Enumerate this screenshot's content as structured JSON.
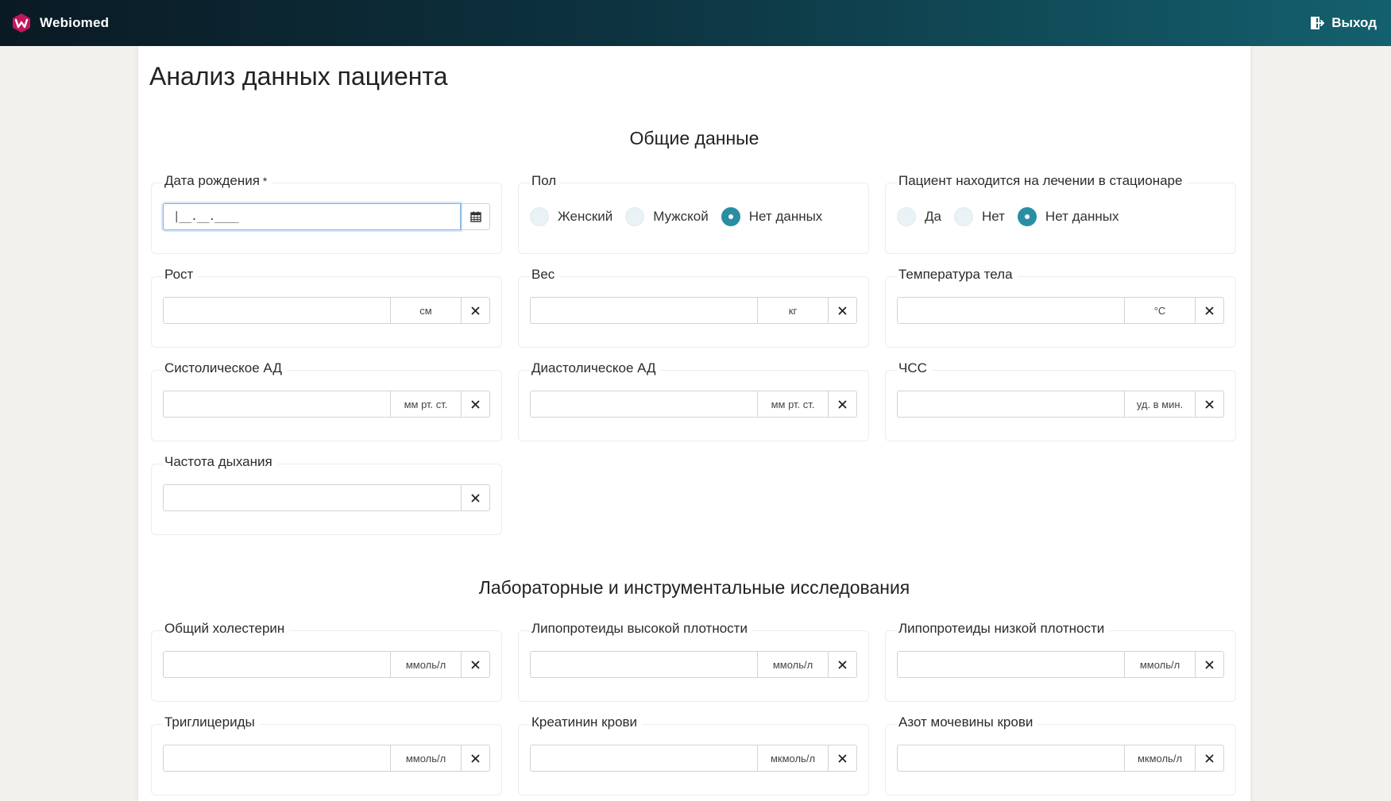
{
  "header": {
    "brand": "Webiomed",
    "logout_label": "Выход"
  },
  "page": {
    "title": "Анализ данных пациента"
  },
  "sections": {
    "general": "Общие данные",
    "lab": "Лабораторные и инструментальные исследования"
  },
  "fields": {
    "birth_date": {
      "label": "Дата рождения",
      "required_mark": "*",
      "mask": "|__.__.____"
    },
    "sex": {
      "label": "Пол",
      "options": [
        "Женский",
        "Мужской",
        "Нет данных"
      ],
      "selected": "Нет данных"
    },
    "inpatient": {
      "label": "Пациент находится на лечении в стационаре",
      "options": [
        "Да",
        "Нет",
        "Нет данных"
      ],
      "selected": "Нет данных"
    },
    "height": {
      "label": "Рост",
      "unit": "см",
      "value": ""
    },
    "weight": {
      "label": "Вес",
      "unit": "кг",
      "value": ""
    },
    "temperature": {
      "label": "Температура тела",
      "unit": "°C",
      "value": ""
    },
    "systolic": {
      "label": "Систолическое АД",
      "unit": "мм рт. ст.",
      "value": ""
    },
    "diastolic": {
      "label": "Диастолическое АД",
      "unit": "мм рт. ст.",
      "value": ""
    },
    "heart_rate": {
      "label": "ЧСС",
      "unit": "уд. в мин.",
      "value": ""
    },
    "resp_rate": {
      "label": "Частота дыхания",
      "value": ""
    },
    "cholesterol": {
      "label": "Общий холестерин",
      "unit": "ммоль/л",
      "value": ""
    },
    "hdl": {
      "label": "Липопротеиды высокой плотности",
      "unit": "ммоль/л",
      "value": ""
    },
    "ldl": {
      "label": "Липопротеиды низкой плотности",
      "unit": "ммоль/л",
      "value": ""
    },
    "triglycerides": {
      "label": "Триглицериды",
      "unit": "ммоль/л",
      "value": ""
    },
    "creatinine": {
      "label": "Креатинин крови",
      "unit": "мкмоль/л",
      "value": ""
    },
    "urea": {
      "label": "Азот мочевины крови",
      "unit": "мкмоль/л",
      "value": ""
    }
  },
  "colors": {
    "accent": "#2a8ea3",
    "header_start": "#0a1a24",
    "header_end": "#14606e"
  }
}
